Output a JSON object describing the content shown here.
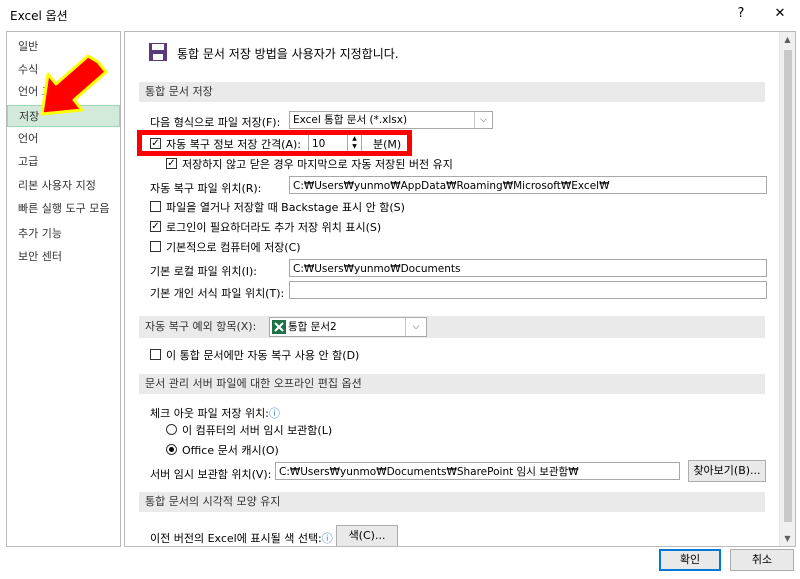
{
  "window": {
    "title": "Excel 옵션",
    "help_label": "?",
    "close_label": "✕"
  },
  "sidebar": {
    "items": [
      {
        "label": "일반"
      },
      {
        "label": "수식"
      },
      {
        "label": "언어 교정"
      },
      {
        "label": "저장"
      },
      {
        "label": "언어"
      },
      {
        "label": "고급"
      },
      {
        "label": "리본 사용자 지정"
      },
      {
        "label": "빠른 실행 도구 모음"
      },
      {
        "label": "추가 기능"
      },
      {
        "label": "보안 센터"
      }
    ]
  },
  "header": {
    "text": "통합 문서 저장 방법을 사용자가 지정합니다."
  },
  "sections": {
    "save": "통합 문서 저장",
    "autorecover_exceptions": "자동 복구 예외 항목(X):",
    "offline": "문서 관리 서버 파일에 대한 오프라인 편집 옵션",
    "visual": "통합 문서의 시각적 모양 유지"
  },
  "save": {
    "format_label": "다음 형식으로 파일 저장(F):",
    "format_value": "Excel 통합 문서 (*.xlsx)",
    "autorecover_label": "자동 복구 정보 저장 간격(A):",
    "autorecover_value": "10",
    "minutes_label": "분(M)",
    "keep_last_label": "저장하지 않고 닫은 경우 마지막으로 자동 저장된 버전 유지",
    "ar_location_label": "자동 복구 파일 위치(R):",
    "ar_location_value": "C:₩Users₩yunmo₩AppData₩Roaming₩Microsoft₩Excel₩",
    "backstage_label": "파일을 열거나 저장할 때 Backstage 표시 안 함(S)",
    "signin_label": "로그인이 필요하더라도 추가 저장 위치 표시(S)",
    "default_computer_label": "기본적으로 컴퓨터에 저장(C)",
    "local_location_label": "기본 로컬 파일 위치(I):",
    "local_location_value": "C:₩Users₩yunmo₩Documents",
    "template_location_label": "기본 개인 서식 파일 위치(T):",
    "template_location_value": ""
  },
  "exceptions": {
    "workbook_value": "통합 문서2",
    "disable_label": "이 통합 문서에만 자동 복구 사용 안 함(D)"
  },
  "offline": {
    "checkout_label": "체크 아웃 파일 저장 위치:",
    "info_icon": "ⓘ",
    "opt_server_label": "이 컴퓨터의 서버 임시 보관함(L)",
    "opt_cache_label": "Office 문서 캐시(O)",
    "drafts_label": "서버 임시 보관함 위치(V):",
    "drafts_value": "C:₩Users₩yunmo₩Documents₩SharePoint 임시 보관함₩",
    "browse_label": "찾아보기(B)..."
  },
  "visual": {
    "colors_label": "이전 버전의 Excel에 표시될 색 선택:",
    "info_icon": "ⓘ",
    "colors_button": "색(C)..."
  },
  "footer": {
    "ok_label": "확인",
    "cancel_label": "취소"
  },
  "glyphs": {
    "check": "✓",
    "chevron": "⌵",
    "spin_up": "▲",
    "spin_down": "▼",
    "scroll_up": "▲",
    "scroll_down": "▼"
  },
  "colors": {
    "selected_bg": "#d3eadb",
    "highlight_red": "#ff0000",
    "arrow_red": "#ff0000",
    "arrow_glow": "#ffff00",
    "primary_border": "#0078d7",
    "excel_green": "#1e7145"
  }
}
